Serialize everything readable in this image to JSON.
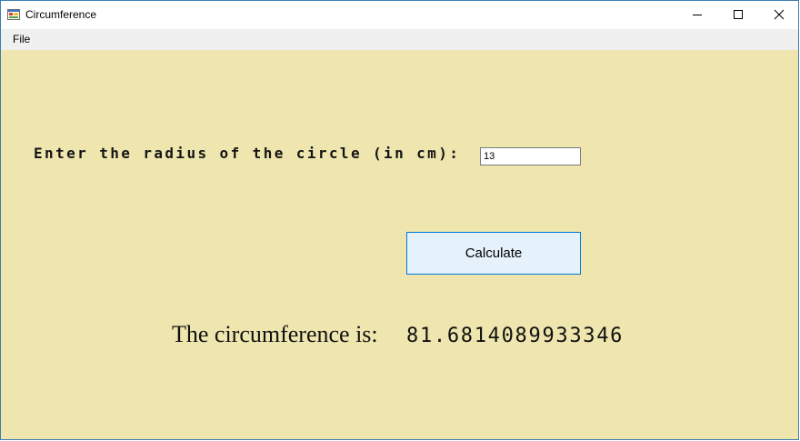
{
  "window": {
    "title": "Circumference",
    "icon": "app-form-icon",
    "controls": [
      "minimize-icon",
      "maximize-icon",
      "close-icon"
    ]
  },
  "menu": {
    "file_label": "File"
  },
  "form": {
    "radius_label": "Enter the radius of the circle (in cm):",
    "radius_value": "13",
    "calculate_label": "Calculate",
    "result_label": "The circumference is:",
    "result_value": "81.6814089933346"
  },
  "colors": {
    "client_background": "#eee6ae",
    "button_background": "#e5f1fb",
    "button_border": "#0078d7",
    "window_border": "#3c7fb1"
  }
}
